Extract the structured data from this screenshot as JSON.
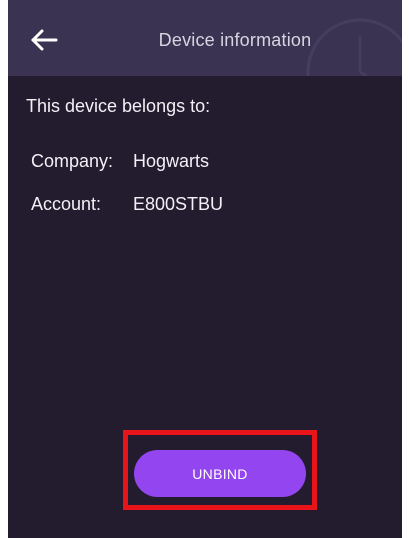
{
  "header": {
    "back_icon": "arrow-left-icon",
    "title": "Device information",
    "watermark_icon": "clock-icon"
  },
  "main": {
    "belongs_text": "This device belongs to:",
    "company_label": "Company:",
    "company_value": "Hogwarts",
    "account_label": "Account:",
    "account_value": "E800STBU"
  },
  "actions": {
    "unbind_label": "UNBIND"
  },
  "colors": {
    "background": "#231c2e",
    "header": "#3b3352",
    "accent": "#9345f0",
    "highlight": "#e8141a"
  }
}
